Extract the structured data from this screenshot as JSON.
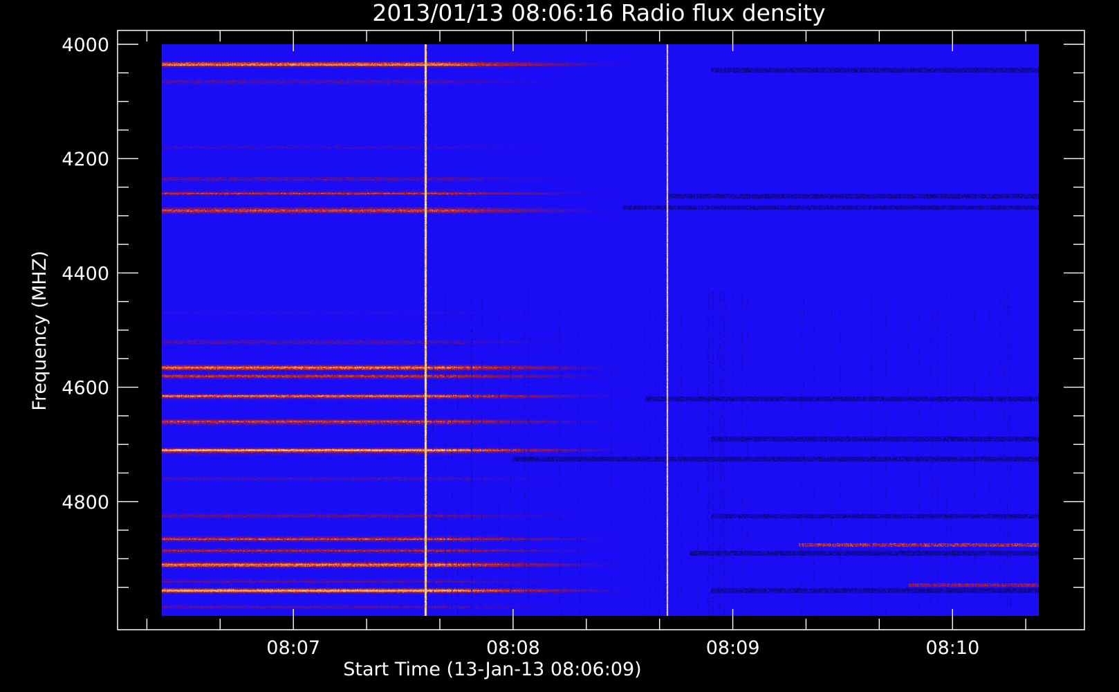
{
  "chart_data": {
    "type": "heatmap",
    "title": "2013/01/13 08:06:16 Radio flux density",
    "xlabel": "Start Time (13-Jan-13 08:06:09)",
    "ylabel": "Frequency (MHZ)",
    "x_start_seconds": 0,
    "x_end_seconds": 240,
    "xlim_minutes_from_0806": [
      0.2,
      4.6
    ],
    "y_range_mhz": [
      4000,
      5000
    ],
    "x_ticks": [
      {
        "minute": 1,
        "label": "08:07"
      },
      {
        "minute": 2,
        "label": "08:08"
      },
      {
        "minute": 3,
        "label": "08:09"
      },
      {
        "minute": 4,
        "label": "08:10"
      }
    ],
    "x_minor_tick_step_minutes": 0.3333,
    "y_ticks": [
      {
        "value": 4000,
        "label": "4000"
      },
      {
        "value": 4200,
        "label": "4200"
      },
      {
        "value": 4400,
        "label": "4400"
      },
      {
        "value": 4600,
        "label": "4600"
      },
      {
        "value": 4800,
        "label": "4800"
      }
    ],
    "y_minor_tick_step_mhz": 50,
    "colors": {
      "background": "#000000",
      "low": "#000000",
      "base": "#1a0df5",
      "mid": "#c01818",
      "high": "#ffd060",
      "peak": "#ffffff"
    },
    "bright_bands": [
      {
        "mhz": 4035,
        "intensity": 0.95
      },
      {
        "mhz": 4065,
        "intensity": 0.55
      },
      {
        "mhz": 4180,
        "intensity": 0.4
      },
      {
        "mhz": 4235,
        "intensity": 0.6
      },
      {
        "mhz": 4260,
        "intensity": 0.7
      },
      {
        "mhz": 4290,
        "intensity": 0.85
      },
      {
        "mhz": 4470,
        "intensity": 0.45
      },
      {
        "mhz": 4520,
        "intensity": 0.5
      },
      {
        "mhz": 4565,
        "intensity": 0.9
      },
      {
        "mhz": 4580,
        "intensity": 0.75
      },
      {
        "mhz": 4615,
        "intensity": 0.85
      },
      {
        "mhz": 4660,
        "intensity": 0.8
      },
      {
        "mhz": 4710,
        "intensity": 0.95
      },
      {
        "mhz": 4760,
        "intensity": 0.45
      },
      {
        "mhz": 4825,
        "intensity": 0.55
      },
      {
        "mhz": 4865,
        "intensity": 0.85
      },
      {
        "mhz": 4885,
        "intensity": 0.7
      },
      {
        "mhz": 4910,
        "intensity": 0.95
      },
      {
        "mhz": 4940,
        "intensity": 0.6
      },
      {
        "mhz": 4955,
        "intensity": 1.0
      },
      {
        "mhz": 4985,
        "intensity": 0.5
      }
    ],
    "dark_bands": [
      {
        "mhz": 4045,
        "from_minute": 2.9
      },
      {
        "mhz": 4265,
        "from_minute": 2.7
      },
      {
        "mhz": 4285,
        "from_minute": 2.5
      },
      {
        "mhz": 4620,
        "from_minute": 2.6
      },
      {
        "mhz": 4690,
        "from_minute": 2.9
      },
      {
        "mhz": 4725,
        "from_minute": 2.0
      },
      {
        "mhz": 4825,
        "from_minute": 2.9
      },
      {
        "mhz": 4890,
        "from_minute": 2.8
      },
      {
        "mhz": 4955,
        "from_minute": 2.9
      }
    ],
    "bright_vertical_lines_minute": [
      1.6,
      2.7
    ],
    "late_bright_bands": [
      {
        "mhz": 4875,
        "from_minute": 3.3,
        "intensity": 0.8
      },
      {
        "mhz": 4945,
        "from_minute": 3.8,
        "intensity": 0.6
      }
    ]
  }
}
